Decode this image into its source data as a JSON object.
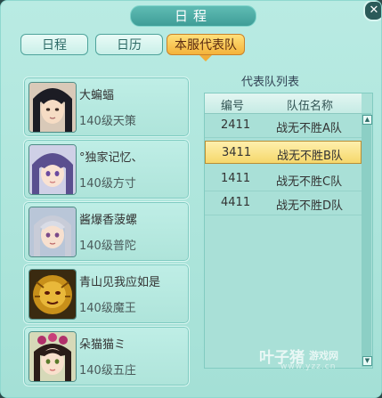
{
  "window": {
    "title": "日程"
  },
  "tabs": [
    {
      "label": "日程",
      "active": false
    },
    {
      "label": "日历",
      "active": false
    },
    {
      "label": "本服代表队",
      "active": true
    }
  ],
  "members": [
    {
      "name": "大蝙蝠",
      "level": "140级天策",
      "avatar": "black-hair-swordsman"
    },
    {
      "name": "°独家记忆、",
      "level": "140级方寸",
      "avatar": "purple-hair-girl"
    },
    {
      "name": "酱爆香菠螺",
      "level": "140级普陀",
      "avatar": "silver-hair-character"
    },
    {
      "name": "青山见我应如是",
      "level": "140级魔王",
      "avatar": "golden-lion-king"
    },
    {
      "name": "朵猫猫ミ",
      "level": "140级五庄",
      "avatar": "black-hair-girl-flowers"
    }
  ],
  "teamList": {
    "title": "代表队列表",
    "headers": {
      "id": "编号",
      "name": "队伍名称"
    },
    "rows": [
      {
        "id": "2411",
        "name": "战无不胜A队",
        "selected": false
      },
      {
        "id": "3411",
        "name": "战无不胜B队",
        "selected": true
      },
      {
        "id": "1411",
        "name": "战无不胜C队",
        "selected": false
      },
      {
        "id": "4411",
        "name": "战无不胜D队",
        "selected": false
      }
    ]
  },
  "watermark": {
    "brand": "叶子猪",
    "sub": "游戏网",
    "url": "www.yzz.cn"
  },
  "colors": {
    "selectedRow": "#f5d76b",
    "activeTab": "#f4b33a",
    "panel": "#a4e0d6"
  }
}
